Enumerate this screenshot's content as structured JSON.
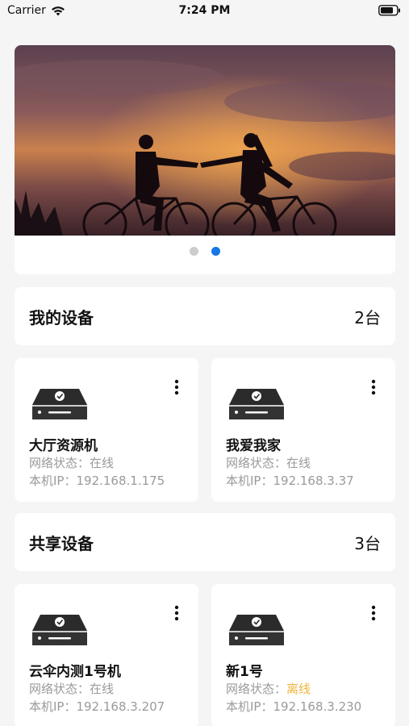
{
  "status_bar": {
    "carrier": "Carrier",
    "time": "7:24 PM"
  },
  "banner": {
    "dots": 2,
    "active_index": 1
  },
  "my_devices": {
    "title": "我的设备",
    "count": "2台",
    "items": [
      {
        "name": "大厅资源机",
        "status_label": "网络状态：",
        "status": "在线",
        "ip_label": "本机IP：",
        "ip": "192.168.1.175"
      },
      {
        "name": "我爱我家",
        "status_label": "网络状态：",
        "status": "在线",
        "ip_label": "本机IP：",
        "ip": "192.168.3.37"
      }
    ]
  },
  "shared_devices": {
    "title": "共享设备",
    "count": "3台",
    "items": [
      {
        "name": "云伞内测1号机",
        "status_label": "网络状态：",
        "status": "在线",
        "ip_label": "本机IP：",
        "ip": "192.168.3.207"
      },
      {
        "name": "新1号",
        "status_label": "网络状态：",
        "status": "离线",
        "ip_label": "本机IP：",
        "ip": "192.168.3.230"
      }
    ]
  },
  "colors": {
    "accent": "#1677e5",
    "offline": "#f2b33d",
    "muted": "#9a9a9a"
  }
}
